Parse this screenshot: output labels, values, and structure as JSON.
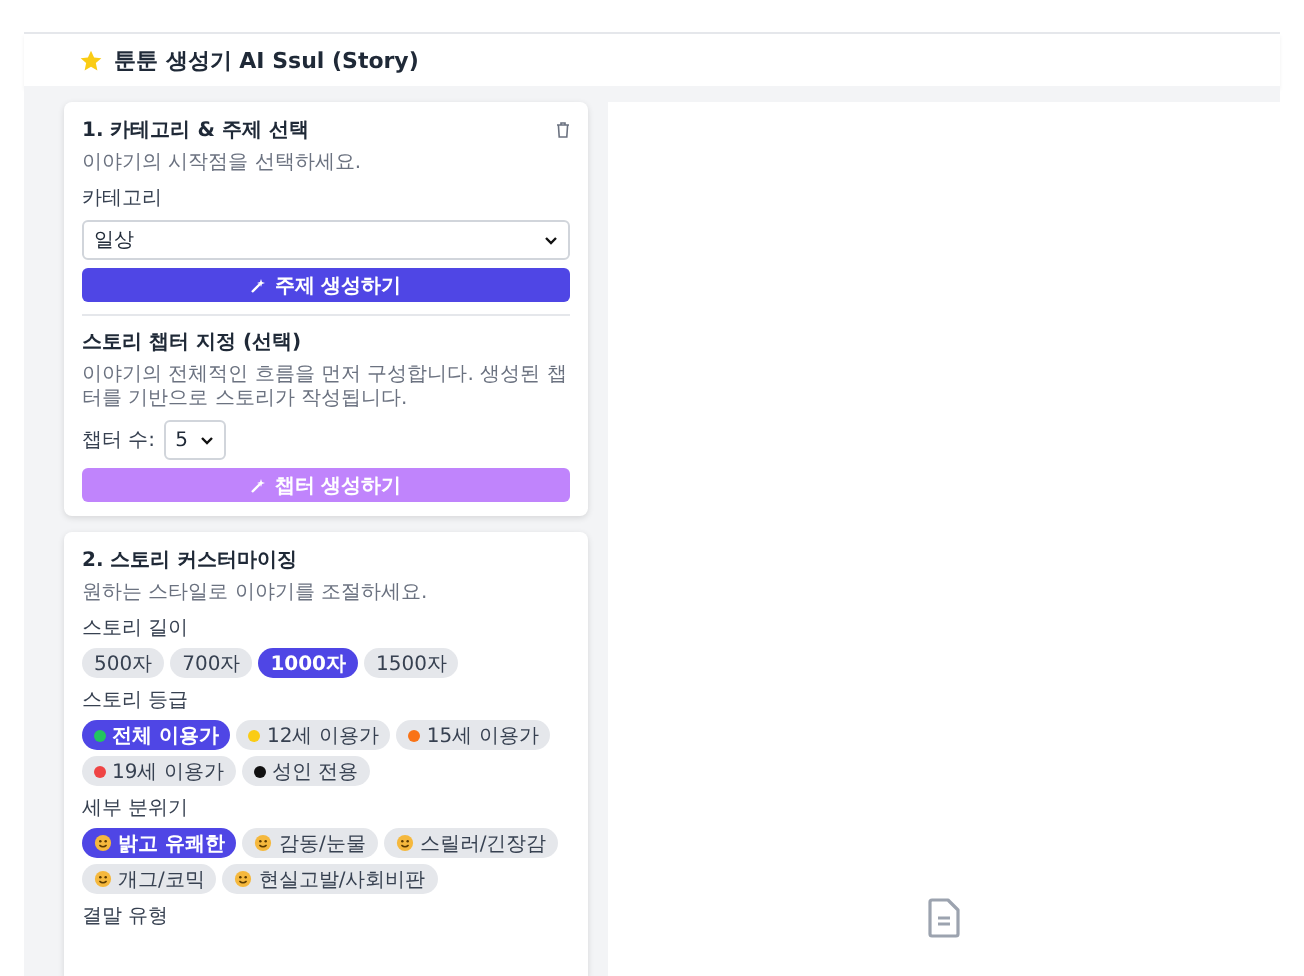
{
  "header": {
    "title": "툰툰 생성기 AI Ssul (Story)"
  },
  "category_card": {
    "title": "1. 카테고리 & 주제 선택",
    "subtitle": "이야기의 시작점을 선택하세요.",
    "category_label": "카테고리",
    "category_value": "일상",
    "topic_button": "주제 생성하기",
    "chapter_title": "스토리 챕터 지정 (선택)",
    "chapter_description": "이야기의 전체적인 흐름을 먼저 구성합니다. 생성된 챕터를 기반으로 스토리가 작성됩니다.",
    "chapter_count_label": "챕터 수:",
    "chapter_count_value": "5",
    "chapter_button": {
      "label": "챕터 생성하기",
      "disabled": true
    }
  },
  "customize_card": {
    "title": "2. 스토리 커스터마이징",
    "subtitle": "원하는 스타일로 이야기를 조절하세요.",
    "groups": [
      {
        "label": "스토리 길이",
        "options": [
          {
            "label": "500자",
            "selected": false
          },
          {
            "label": "700자",
            "selected": false
          },
          {
            "label": "1000자",
            "selected": true
          },
          {
            "label": "1500자",
            "selected": false
          }
        ]
      },
      {
        "label": "스토리 등급",
        "options": [
          {
            "label": "전체 이용가",
            "selected": true,
            "color": "#22c55e"
          },
          {
            "label": "12세 이용가",
            "selected": false,
            "color": "#facc15"
          },
          {
            "label": "15세 이용가",
            "selected": false,
            "color": "#f97316"
          },
          {
            "label": "19세 이용가",
            "selected": false,
            "color": "#ef4444"
          },
          {
            "label": "성인 전용",
            "selected": false,
            "color": "#111111"
          }
        ]
      },
      {
        "label": "세부 분위기",
        "options": [
          {
            "label": "밝고 유쾌한",
            "selected": true,
            "kind": "emoji"
          },
          {
            "label": "감동/눈물",
            "selected": false,
            "kind": "emoji"
          },
          {
            "label": "스릴러/긴장감",
            "selected": false,
            "kind": "emoji"
          },
          {
            "label": "개그/코믹",
            "selected": false,
            "kind": "emoji"
          },
          {
            "label": "현실고발/사회비판",
            "selected": false,
            "kind": "emoji"
          }
        ]
      }
    ],
    "next_label": "결말 유형"
  }
}
